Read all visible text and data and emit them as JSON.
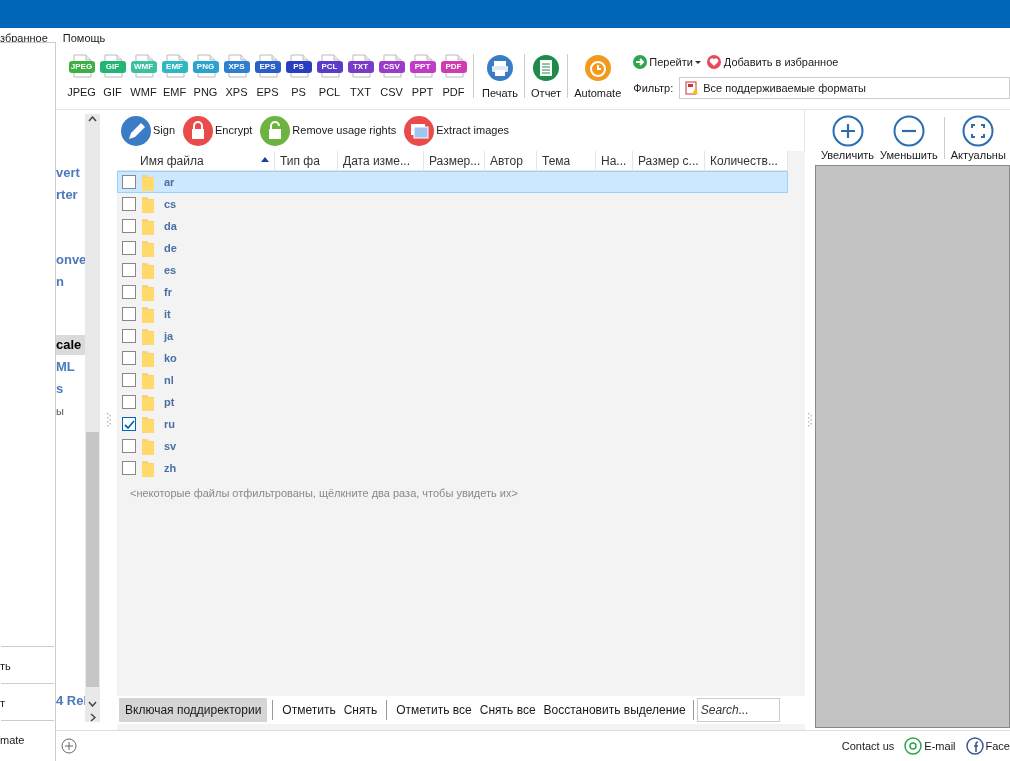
{
  "menu_bar": [
    {
      "label": "збранное"
    },
    {
      "label": "Помощь"
    }
  ],
  "dropdown_menu": {
    "items": [
      {
        "label": "ть"
      },
      {
        "label": "т"
      },
      {
        "label": "mate"
      }
    ]
  },
  "format_buttons": [
    {
      "badge": "JPEG",
      "label": "JPEG",
      "color": "#3cb043"
    },
    {
      "badge": "GIF",
      "label": "GIF",
      "color": "#22b573"
    },
    {
      "badge": "WMF",
      "label": "WMF",
      "color": "#3cc0a0"
    },
    {
      "badge": "EMF",
      "label": "EMF",
      "color": "#30b8c0"
    },
    {
      "badge": "PNG",
      "label": "PNG",
      "color": "#2ba3d0"
    },
    {
      "badge": "XPS",
      "label": "XPS",
      "color": "#2f7fd0"
    },
    {
      "badge": "EPS",
      "label": "EPS",
      "color": "#2a5fc8"
    },
    {
      "badge": "PS",
      "label": "PS",
      "color": "#2a3fc0"
    },
    {
      "badge": "PCL",
      "label": "PCL",
      "color": "#5b3cc8"
    },
    {
      "badge": "TXT",
      "label": "TXT",
      "color": "#7a3cc8"
    },
    {
      "badge": "CSV",
      "label": "CSV",
      "color": "#9a3cc8"
    },
    {
      "badge": "PPT",
      "label": "PPT",
      "color": "#c03cc8"
    },
    {
      "badge": "PDF",
      "label": "PDF",
      "color": "#d03cb0"
    }
  ],
  "toolbar_buttons": [
    {
      "label": "Печать",
      "kind": "print"
    },
    {
      "label": "Отчет",
      "kind": "report"
    },
    {
      "label": "Automate",
      "kind": "automate"
    }
  ],
  "goto": {
    "label": "Перейти"
  },
  "favorite": {
    "label": "Добавить в избранное"
  },
  "filter": {
    "label": "Фильтр:",
    "value": "Все поддерживаемые форматы"
  },
  "tree": {
    "items": [
      {
        "label": "vert",
        "selected": false
      },
      {
        "label": "rter",
        "selected": false
      },
      {
        "label": "onve",
        "selected": false
      },
      {
        "label": "n",
        "selected": false
      },
      {
        "label": "cale",
        "selected": true
      },
      {
        "label": "ML",
        "selected": false
      },
      {
        "label": "s",
        "selected": false
      },
      {
        "label": "ы",
        "selected": false
      },
      {
        "label": "4 Rel",
        "selected": false
      }
    ]
  },
  "actions": [
    {
      "label": "Sign",
      "kind": "sign"
    },
    {
      "label": "Encrypt",
      "kind": "encrypt"
    },
    {
      "label": "Remove usage rights",
      "kind": "unlock"
    },
    {
      "label": "Extract images",
      "kind": "images"
    }
  ],
  "table": {
    "columns": [
      {
        "label": "Имя файла",
        "sorted": true
      },
      {
        "label": "Тип фа",
        "sorted": false
      },
      {
        "label": "Дата изме...",
        "sorted": false
      },
      {
        "label": "Размер...",
        "sorted": false
      },
      {
        "label": "Автор",
        "sorted": false
      },
      {
        "label": "Тема",
        "sorted": false
      },
      {
        "label": "На...",
        "sorted": false
      },
      {
        "label": "Размер с...",
        "sorted": false
      },
      {
        "label": "Количеств...",
        "sorted": false
      }
    ],
    "rows": [
      {
        "name": "ar",
        "checked": false,
        "selected": true
      },
      {
        "name": "cs",
        "checked": false,
        "selected": false
      },
      {
        "name": "da",
        "checked": false,
        "selected": false
      },
      {
        "name": "de",
        "checked": false,
        "selected": false
      },
      {
        "name": "es",
        "checked": false,
        "selected": false
      },
      {
        "name": "fr",
        "checked": false,
        "selected": false
      },
      {
        "name": "it",
        "checked": false,
        "selected": false
      },
      {
        "name": "ja",
        "checked": false,
        "selected": false
      },
      {
        "name": "ko",
        "checked": false,
        "selected": false
      },
      {
        "name": "nl",
        "checked": false,
        "selected": false
      },
      {
        "name": "pt",
        "checked": false,
        "selected": false
      },
      {
        "name": "ru",
        "checked": true,
        "selected": false
      },
      {
        "name": "sv",
        "checked": false,
        "selected": false
      },
      {
        "name": "zh",
        "checked": false,
        "selected": false
      }
    ],
    "note": "<некоторые файлы отфильтрованы, щёлкните два раза, чтобы увидеть их>"
  },
  "bottom_bar": {
    "toggle": {
      "label": "Включая поддиректории",
      "on": true
    },
    "groups": [
      [
        "Отметить",
        "Снять"
      ],
      [
        "Отметить все",
        "Снять все",
        "Восстановить выделение"
      ]
    ],
    "search": {
      "placeholder": "Search..."
    }
  },
  "preview_toolbar": [
    {
      "label": "Увеличить",
      "kind": "zoom-in"
    },
    {
      "label": "Уменьшить",
      "kind": "zoom-out"
    },
    {
      "label": "Актуальны",
      "kind": "actual"
    }
  ],
  "status_bar": {
    "links": [
      {
        "label": "Contact us",
        "kind": "text"
      },
      {
        "label": "E-mail",
        "kind": "email"
      },
      {
        "label": "Face",
        "kind": "facebook"
      }
    ]
  }
}
